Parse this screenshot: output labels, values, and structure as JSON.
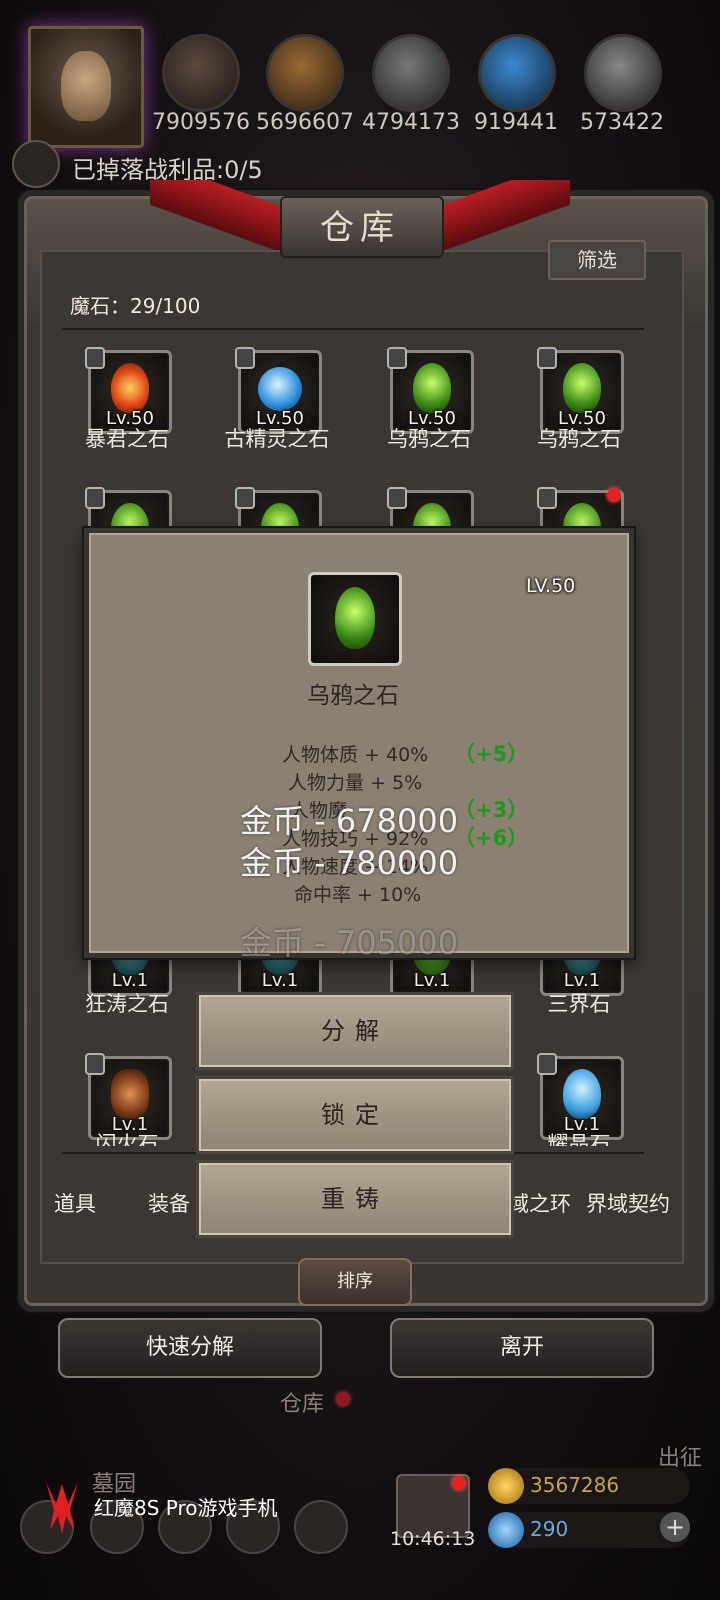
{
  "resources": {
    "values": [
      "7909576",
      "5696607",
      "4794173",
      "919441",
      "573422"
    ],
    "loot_text": "已掉落战利品:0/5"
  },
  "warehouse": {
    "title": "仓库",
    "filter_label": "筛选",
    "stone_count": "魔石：29/100"
  },
  "grid": {
    "row1": [
      {
        "level": "Lv.50",
        "name": "暴君之石"
      },
      {
        "level": "Lv.50",
        "name": "古精灵之石"
      },
      {
        "level": "Lv.50",
        "name": "乌鸦之石"
      },
      {
        "level": "Lv.50",
        "name": "乌鸦之石"
      }
    ],
    "row3": [
      {
        "level": "Lv.1",
        "name": "狂涛之石"
      },
      {
        "level": "Lv.1",
        "name": ""
      },
      {
        "level": "Lv.1",
        "name": ""
      },
      {
        "level": "Lv.1",
        "name": "三界石"
      }
    ],
    "row4": [
      {
        "level": "Lv.1",
        "name": "闪火石"
      },
      {
        "level": "Lv.1",
        "name": "耀晶石"
      }
    ]
  },
  "popup": {
    "level": "LV.50",
    "name": "乌鸦之石",
    "stats": [
      "人物体质 + 40%",
      "人物力量 + 5%",
      "人物魔",
      "人物技巧 + 92%",
      "人物速度 + 14%",
      "命中率 + 10%"
    ],
    "bonuses": [
      "（+5）",
      "（+3）",
      "（+6）"
    ],
    "floating": [
      "金币 - 678000",
      "金币 - 780000",
      "金币 - 705000"
    ]
  },
  "actions": {
    "decompose": "分解",
    "lock": "锁定",
    "recast": "重铸"
  },
  "tabs": [
    "道具",
    "装备",
    "域之环",
    "界域契约"
  ],
  "sort_label": "排序",
  "bottom_buttons": {
    "quick_decompose": "快速分解",
    "leave": "离开"
  },
  "footer": {
    "warehouse_tab": "仓库",
    "graveyard": "墓园",
    "expedition": "出征",
    "gold": "3567286",
    "gems": "290",
    "time": "10:46:13",
    "brand": "红魔8S Pro游戏手机"
  }
}
